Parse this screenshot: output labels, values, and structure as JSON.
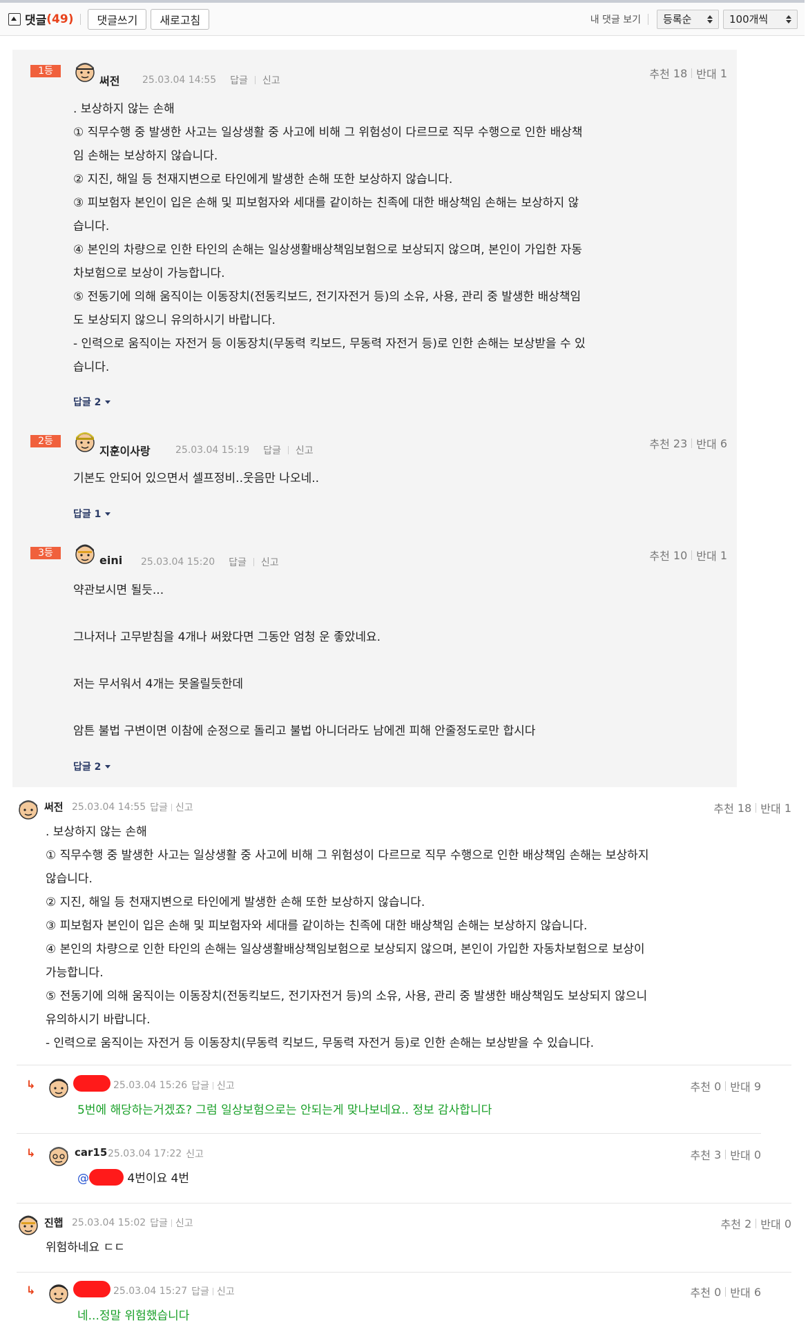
{
  "toolbar": {
    "title": "댓글",
    "count": "(49)",
    "write_button": "댓글쓰기",
    "refresh_button": "새로고침",
    "my_comments": "내 댓글 보기",
    "sort_select": "등록순",
    "per_page_select": "100개씩"
  },
  "labels": {
    "reply": "답글",
    "report": "신고",
    "recommend": "추천",
    "oppose": "반대"
  },
  "best": [
    {
      "rank": "1등",
      "nick": "써전",
      "time": "25.03.04 14:55",
      "up": "18",
      "down": "1",
      "lines": [
        ". 보상하지 않는 손해",
        "① 직무수행 중 발생한 사고는 일상생활 중 사고에 비해 그 위험성이 다르므로 직무 수행으로 인한 배상책",
        "임 손해는 보상하지 않습니다.",
        "② 지진, 해일 등 천재지변으로 타인에게 발생한 손해 또한 보상하지 않습니다.",
        "③ 피보험자 본인이 입은 손해 및 피보험자와 세대를 같이하는 친족에 대한 배상책임 손해는 보상하지 않",
        "습니다.",
        "④ 본인의 차량으로 인한 타인의 손해는 일상생활배상책임보험으로 보상되지 않으며, 본인이 가입한 자동",
        "차보험으로 보상이 가능합니다.",
        "⑤ 전동기에 의해 움직이는 이동장치(전동킥보드, 전기자전거 등)의 소유, 사용, 관리 중 발생한 배상책임",
        "도 보상되지 않으니 유의하시기 바랍니다.",
        "- 인력으로 움직이는 자전거 등 이동장치(무동력 킥보드, 무동력 자전거 등)로 인한 손해는 보상받을 수 있",
        "습니다."
      ],
      "replies": "답글 2"
    },
    {
      "rank": "2등",
      "nick": "지훈이사랑",
      "time": "25.03.04 15:19",
      "up": "23",
      "down": "6",
      "lines": [
        "기본도 안되어 있으면서 셀프정비..웃음만 나오네.."
      ],
      "replies": "답글 1"
    },
    {
      "rank": "3등",
      "nick": "eini",
      "time": "25.03.04 15:20",
      "up": "10",
      "down": "1",
      "lines": [
        "약관보시면 될듯...",
        "",
        "그나저나 고무받침을 4개나 써왔다면 그동안 엄청 운 좋았네요.",
        "",
        "저는 무서워서 4개는 못올릴듯한데",
        "",
        "암튼 불법 구변이면 이참에 순정으로 돌리고 불법 아니더라도 남에겐 피해 안줄정도로만 합시다"
      ],
      "replies": "답글 2"
    }
  ],
  "comments": [
    {
      "nick": "써전",
      "time": "25.03.04 14:55",
      "up": "18",
      "down": "1",
      "lines": [
        ". 보상하지 않는 손해",
        "① 직무수행 중 발생한 사고는 일상생활 중 사고에 비해 그 위험성이 다르므로 직무 수행으로 인한 배상책임 손해는 보상하지",
        "않습니다.",
        "② 지진, 해일 등 천재지변으로 타인에게 발생한 손해 또한 보상하지 않습니다.",
        "③ 피보험자 본인이 입은 손해 및 피보험자와 세대를 같이하는 친족에 대한 배상책임 손해는 보상하지 않습니다.",
        "④ 본인의 차량으로 인한 타인의 손해는 일상생활배상책임보험으로 보상되지 않으며, 본인이 가입한 자동차보험으로 보상이",
        "가능합니다.",
        "⑤ 전동기에 의해 움직이는 이동장치(전동킥보드, 전기자전거 등)의 소유, 사용, 관리 중 발생한 배상책임도 보상되지 않으니",
        "유의하시기 바랍니다.",
        "- 인력으로 움직이는 자전거 등 이동장치(무동력 킥보드, 무동력 자전거 등)로 인한 손해는 보상받을 수 있습니다."
      ]
    },
    {
      "time": "25.03.04 15:26",
      "up": "0",
      "down": "9",
      "text": "5번에 해당하는거겠죠? 그럼 일상보험으로는 안되는게 맞나보네요.. 정보 감사합니다"
    },
    {
      "nick": "car15",
      "time": "25.03.04 17:22",
      "up": "3",
      "down": "0",
      "mention": "@",
      "text": " 4번이요 4번"
    },
    {
      "nick": "진햅",
      "time": "25.03.04 15:02",
      "up": "2",
      "down": "0",
      "text": "위험하네요 ㄷㄷ"
    },
    {
      "time": "25.03.04 15:27",
      "up": "0",
      "down": "6",
      "text": "네...정말 위험했습니다"
    }
  ],
  "colors": {
    "accent_red": "#e8431c",
    "rank_badge": "#f0603c",
    "reply_green": "#19a028",
    "mention_blue": "#2050d0",
    "best_bg": "#f4f4f4"
  },
  "icons": [
    "collapse-up-icon",
    "avatar-icon",
    "reply-arrow-icon",
    "caret-down-icon",
    "select-arrows-icon"
  ]
}
